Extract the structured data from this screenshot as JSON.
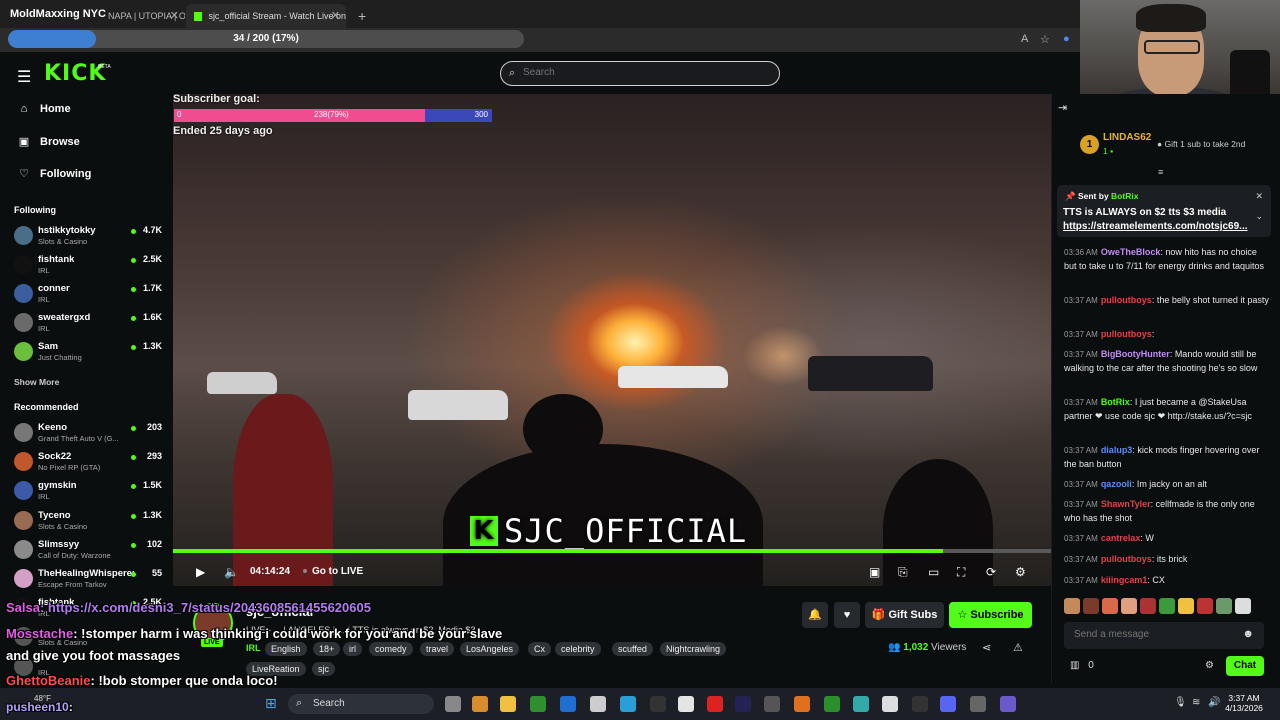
{
  "browser": {
    "overlay_title": "MoldMaxxing NYC",
    "tab1": "NAPA | UTOPIA | OC",
    "tab2": "sjc_official Stream - Watch Live on",
    "new_tab": "+",
    "progress_text": "34 / 200 (17%)",
    "progress_fraction": 0.17
  },
  "header": {
    "logo": "KICK",
    "logo_badge": "BETA",
    "search_placeholder": "Search"
  },
  "sidebar": {
    "nav": [
      {
        "label": "Home",
        "icon": "home-icon"
      },
      {
        "label": "Browse",
        "icon": "browse-icon"
      },
      {
        "label": "Following",
        "icon": "heart-icon"
      }
    ],
    "following_title": "Following",
    "following": [
      {
        "name": "hstikkytokky",
        "category": "Slots & Casino",
        "viewers": "4.7K",
        "color": "#4a6d88"
      },
      {
        "name": "fishtank",
        "category": "IRL",
        "viewers": "2.5K",
        "color": "#111111"
      },
      {
        "name": "conner",
        "category": "IRL",
        "viewers": "1.7K",
        "color": "#3b5f9e"
      },
      {
        "name": "sweatergxd",
        "category": "IRL",
        "viewers": "1.6K",
        "color": "#6a6a6a"
      },
      {
        "name": "Sam",
        "category": "Just Chatting",
        "viewers": "1.3K",
        "color": "#6cbf3a"
      }
    ],
    "show_more": "Show More",
    "recommended_title": "Recommended",
    "recommended": [
      {
        "name": "Keeno",
        "category": "Grand Theft Auto V (G...",
        "viewers": "203",
        "color": "#777777"
      },
      {
        "name": "Sock22",
        "category": "No Pixel RP (GTA)",
        "viewers": "293",
        "color": "#c2562c"
      },
      {
        "name": "gymskin",
        "category": "IRL",
        "viewers": "1.5K",
        "color": "#3d5aa8"
      },
      {
        "name": "Tyceno",
        "category": "Slots & Casino",
        "viewers": "1.3K",
        "color": "#9a6b53"
      },
      {
        "name": "Slimssyy",
        "category": "Call of Duty: Warzone",
        "viewers": "102",
        "color": "#8a8a8a"
      },
      {
        "name": "TheHealingWhisperer",
        "category": "Escape From Tarkov",
        "viewers": "55",
        "color": "#d4a0c8"
      },
      {
        "name": "fishtank",
        "category": "IRL",
        "viewers": "2.5K",
        "color": "#111111"
      },
      {
        "name": "",
        "category": "Slots & Casino",
        "viewers": "",
        "color": "#555555"
      },
      {
        "name": "",
        "category": "IRL",
        "viewers": "",
        "color": "#555555"
      }
    ]
  },
  "video": {
    "sub_goal_label": "Subscriber goal:",
    "sub_goal_start": "0",
    "sub_goal_progress": "238(79%)",
    "sub_goal_end": "300",
    "sub_goal_fraction": 0.79,
    "sub_goal_ended": "Ended 25 days ago",
    "watermark": "SJC_OFFICIAL",
    "watermark_k": "K",
    "seek_fraction": 0.877,
    "time": "04:14:24",
    "go_live": "Go to LIVE"
  },
  "stream": {
    "streamer": "sjc_official",
    "live_badge": "LIVE",
    "title": "LIVE - ... | ANGELES | ... | TTS is always on $2, Media $3",
    "category": "IRL",
    "tags": [
      "English",
      "18+",
      "irl",
      "comedy",
      "travel",
      "LosAngeles",
      "Cx",
      "celebrity",
      "scuffed",
      "Nightcrawling",
      "LiveReation",
      "sjc"
    ],
    "gift_subs": "Gift Subs",
    "subscribe": "Subscribe",
    "viewers_count": "1,032",
    "viewers_label": "Viewers"
  },
  "overlay_chat": [
    {
      "user": "Salsa",
      "text": ": https://x.com/desni3_7/status/2043608561455620605"
    },
    {
      "user": "Mosstache",
      "text": ": !stomper harm i was thinking i could work for you and be your slave"
    },
    {
      "user": "",
      "text": "and give you foot massages"
    },
    {
      "user": "GhettoBeanie",
      "text": ": !bob stomper que onda loco!"
    },
    {
      "user": "pusheen10",
      "text": ":"
    }
  ],
  "chat": {
    "top_gifter_rank": "1",
    "top_gifter": "LINDAS62",
    "top_gifter_count": "1",
    "gift_hint": "Gift 1 sub to take 2nd",
    "pinned_by_prefix": "Sent by",
    "pinned_by_user": "BotRix",
    "pinned_message": "TTS is ALWAYS on $2 tts $3 media",
    "pinned_link": "https://streamelements.com/notsjc69...",
    "messages": [
      {
        "time": "03:36 AM",
        "user": "OweTheBlock",
        "color": "#c38cf7",
        "text": ": now hito has no choice but to take u to 7/11 for energy drinks and taquitos"
      },
      {
        "time": "03:37 AM",
        "user": "pulloutboys",
        "color": "#e0434b",
        "text": ": the belly shot turned it pasty"
      },
      {
        "time": "03:37 AM",
        "user": "pulloutboys",
        "color": "#e0434b",
        "text": ":"
      },
      {
        "time": "03:37 AM",
        "user": "BigBootyHunter",
        "color": "#c38cf7",
        "text": ": Mando would still be walking to the car after the shooting he's so slow"
      },
      {
        "time": "03:37 AM",
        "user": "BotRix",
        "color": "#53fc18",
        "text": ": I just became a @StakeUsa partner ❤ use code sjc ❤ http://stake.us/?c=sjc"
      },
      {
        "time": "03:37 AM",
        "user": "dialup3",
        "color": "#5b8ef5",
        "text": ": kick mods finger hovering over the ban button"
      },
      {
        "time": "03:37 AM",
        "user": "qazooli",
        "color": "#5b8ef5",
        "text": ": Im jacky on an alt"
      },
      {
        "time": "03:37 AM",
        "user": "ShawnTyler",
        "color": "#e0434b",
        "text": ": cellfmade is the only one who has the shot"
      },
      {
        "time": "03:37 AM",
        "user": "cantrelax",
        "color": "#e0434b",
        "text": ": W"
      },
      {
        "time": "03:37 AM",
        "user": "pulloutboys",
        "color": "#e0434b",
        "text": ": its brick"
      },
      {
        "time": "03:37 AM",
        "user": "kiiingcam1",
        "color": "#e0434b",
        "text": ": CX"
      }
    ],
    "send_placeholder": "Send a message",
    "points": "0",
    "chat_button": "Chat"
  },
  "taskbar": {
    "weather": "48°F",
    "search": "Search",
    "time": "3:37 AM",
    "date": "4/13/2026"
  }
}
